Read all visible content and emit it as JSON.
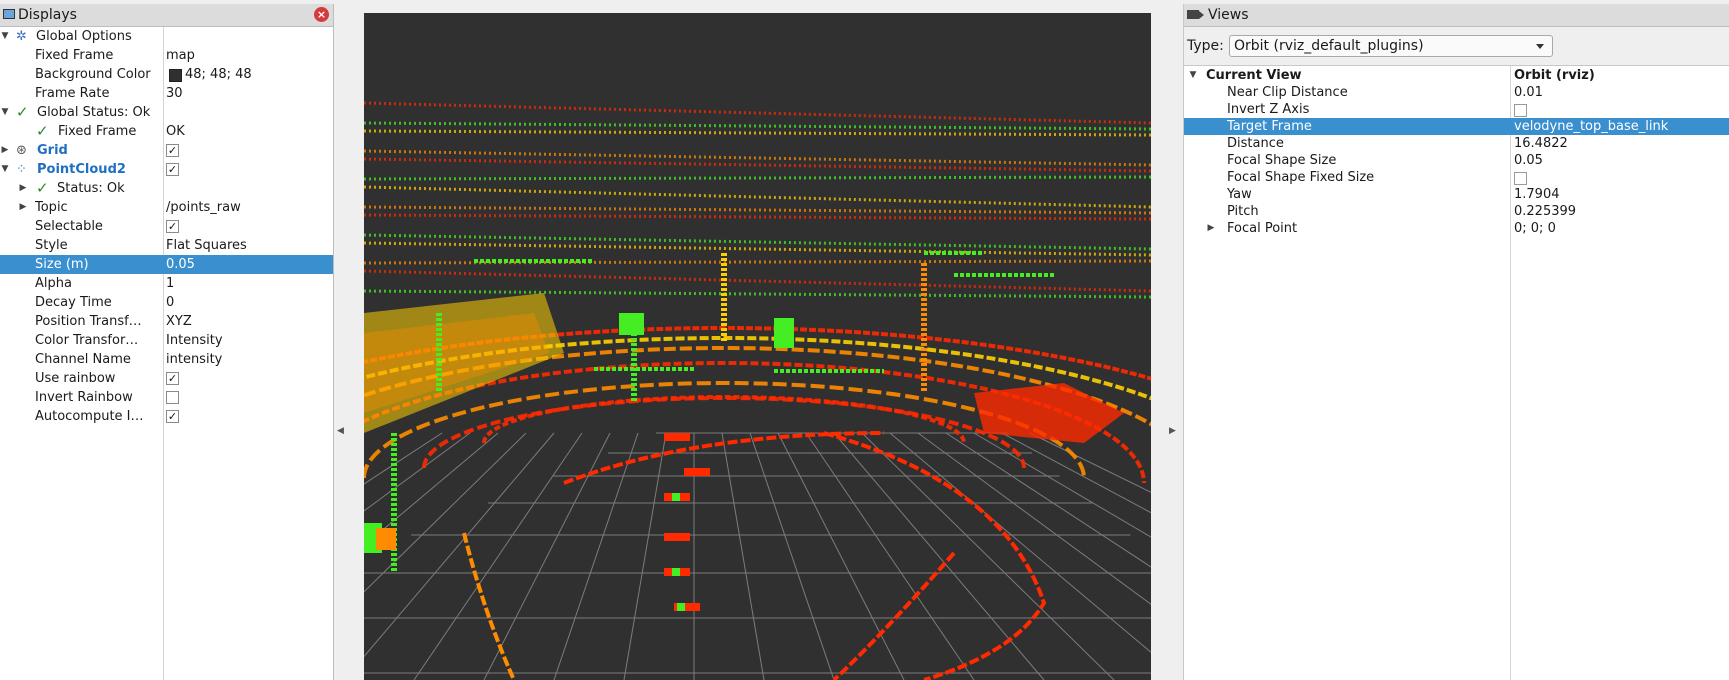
{
  "displays": {
    "title": "Displays",
    "rows": [
      {
        "label": "Global Options",
        "value": ""
      },
      {
        "label": "Fixed Frame",
        "value": "map"
      },
      {
        "label": "Background Color",
        "value": "48; 48; 48"
      },
      {
        "label": "Frame Rate",
        "value": "30"
      },
      {
        "label": "Global Status: Ok",
        "value": ""
      },
      {
        "label": "Fixed Frame",
        "value": "OK"
      },
      {
        "label": "Grid",
        "value": ""
      },
      {
        "label": "PointCloud2",
        "value": ""
      },
      {
        "label": "Status: Ok",
        "value": ""
      },
      {
        "label": "Topic",
        "value": "/points_raw"
      },
      {
        "label": "Selectable",
        "value": ""
      },
      {
        "label": "Style",
        "value": "Flat Squares"
      },
      {
        "label": "Size (m)",
        "value": "0.05"
      },
      {
        "label": "Alpha",
        "value": "1"
      },
      {
        "label": "Decay Time",
        "value": "0"
      },
      {
        "label": "Position Transf…",
        "value": "XYZ"
      },
      {
        "label": "Color Transfor…",
        "value": "Intensity"
      },
      {
        "label": "Channel Name",
        "value": "intensity"
      },
      {
        "label": "Use rainbow",
        "value": ""
      },
      {
        "label": "Invert Rainbow",
        "value": ""
      },
      {
        "label": "Autocompute I…",
        "value": ""
      }
    ],
    "checked": {
      "grid": true,
      "pointcloud2": true,
      "selectable": true,
      "use_rainbow": true,
      "invert_rainbow": false,
      "autocompute": true
    },
    "background_color_hex": "#303030",
    "selected_row": "Size (m)"
  },
  "viewport": {
    "background": "#303030",
    "grid_color": "#8a8a8a",
    "cloud_colors": [
      "#ff2a00",
      "#ff8c00",
      "#ffd000",
      "#44ee22"
    ]
  },
  "views": {
    "title": "Views",
    "type_label": "Type:",
    "type_value": "Orbit (rviz_default_plugins)",
    "rows": [
      {
        "label": "Current View",
        "value": "Orbit (rviz)"
      },
      {
        "label": "Near Clip Distance",
        "value": "0.01"
      },
      {
        "label": "Invert Z Axis",
        "value": ""
      },
      {
        "label": "Target Frame",
        "value": "velodyne_top_base_link"
      },
      {
        "label": "Distance",
        "value": "16.4822"
      },
      {
        "label": "Focal Shape Size",
        "value": "0.05"
      },
      {
        "label": "Focal Shape Fixed Size",
        "value": ""
      },
      {
        "label": "Yaw",
        "value": "1.7904"
      },
      {
        "label": "Pitch",
        "value": "0.225399"
      },
      {
        "label": "Focal Point",
        "value": "0; 0; 0"
      }
    ],
    "checked": {
      "invert_z_axis": false,
      "focal_shape_fixed_size": false
    },
    "selected_row": "Target Frame"
  },
  "accent_color": "#3a8fce"
}
